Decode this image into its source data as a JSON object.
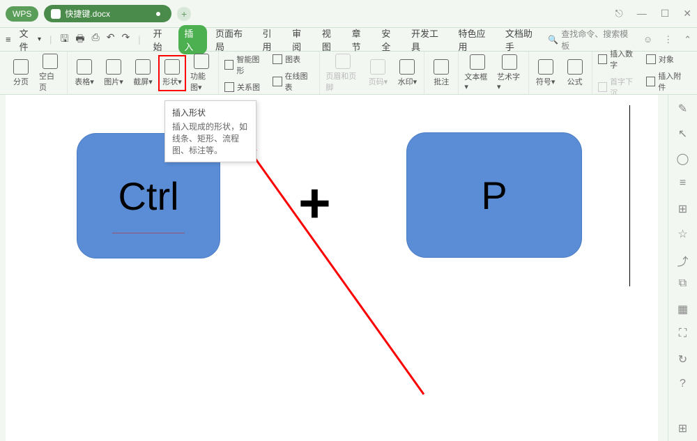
{
  "titlebar": {
    "app_name": "WPS",
    "doc_name": "快捷键.docx"
  },
  "menubar": {
    "file": "文件",
    "items": [
      "开始",
      "插入",
      "页面布局",
      "引用",
      "审阅",
      "视图",
      "章节",
      "安全",
      "开发工具",
      "特色应用",
      "文档助手"
    ],
    "active_index": 1,
    "search_placeholder": "查找命令、搜索模板"
  },
  "toolbar": {
    "group1": [
      {
        "label": "分页",
        "name": "page-break"
      },
      {
        "label": "空白页",
        "name": "blank-page"
      }
    ],
    "group2": [
      {
        "label": "表格",
        "name": "table"
      },
      {
        "label": "图片",
        "name": "picture"
      },
      {
        "label": "截屏",
        "name": "screenshot"
      },
      {
        "label": "形状",
        "name": "shape"
      },
      {
        "label": "功能图",
        "name": "function-diagram"
      }
    ],
    "group3_stack": [
      {
        "label": "智能图形",
        "name": "smart-art"
      },
      {
        "label": "关系图",
        "name": "relation-chart"
      }
    ],
    "group3_stack2": [
      {
        "label": "图表",
        "name": "chart"
      },
      {
        "label": "在线图表",
        "name": "online-chart"
      }
    ],
    "group4": [
      {
        "label": "页眉和页脚",
        "name": "header-footer",
        "disabled": true
      },
      {
        "label": "页码",
        "name": "page-number",
        "disabled": true
      },
      {
        "label": "水印",
        "name": "watermark"
      }
    ],
    "group5": [
      {
        "label": "批注",
        "name": "comment"
      }
    ],
    "group6": [
      {
        "label": "文本框",
        "name": "textbox"
      },
      {
        "label": "艺术字",
        "name": "wordart"
      }
    ],
    "group7": [
      {
        "label": "符号",
        "name": "symbol"
      },
      {
        "label": "公式",
        "name": "formula"
      }
    ],
    "group8_stack": [
      {
        "label": "插入数字",
        "name": "insert-number"
      },
      {
        "label": "首字下沉",
        "name": "drop-cap",
        "disabled": true
      }
    ],
    "group8_stack2": [
      {
        "label": "对象",
        "name": "object"
      },
      {
        "label": "插入附件",
        "name": "attachment"
      }
    ]
  },
  "tooltip": {
    "title": "插入形状",
    "desc": "插入现成的形状，如线条、矩形、流程图、标注等。"
  },
  "canvas": {
    "ctrl_text": "Ctrl",
    "plus_text": "+",
    "p_text": "P"
  },
  "sidebar_icons": [
    "pencil",
    "cursor",
    "shape",
    "line",
    "gallery",
    "star",
    "share",
    "screen",
    "chart",
    "image",
    "history",
    "help"
  ]
}
